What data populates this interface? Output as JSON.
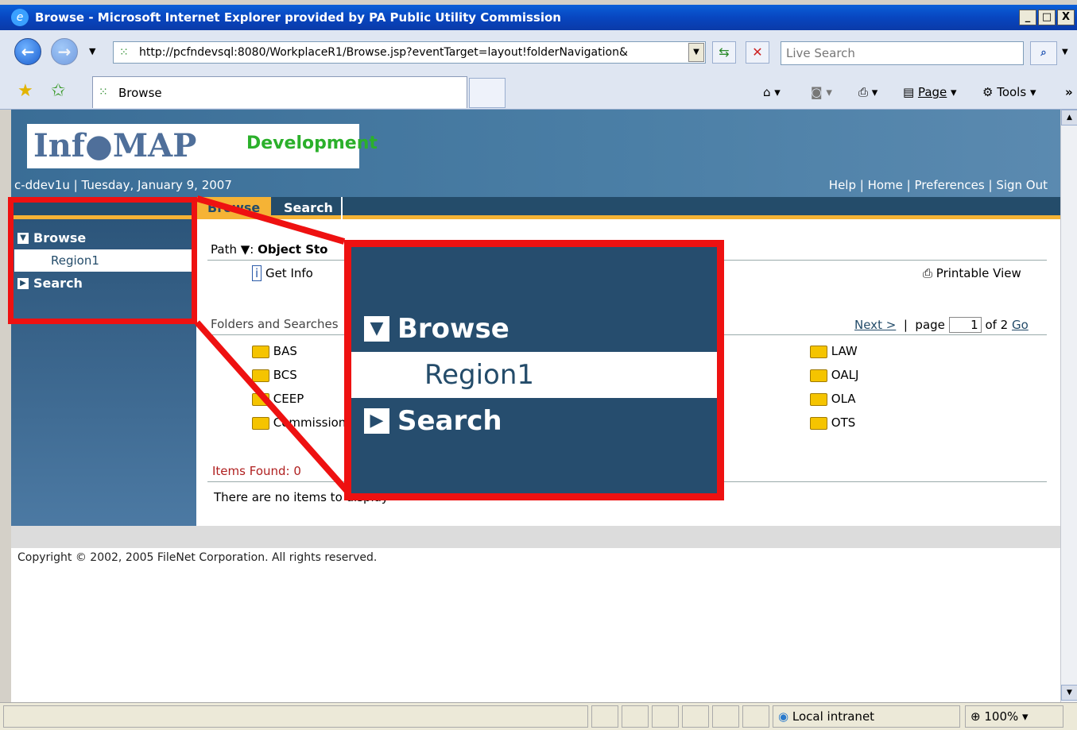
{
  "window": {
    "title": "Browse - Microsoft Internet Explorer provided by PA Public Utility Commission",
    "min": "_",
    "max": "□",
    "close": "X"
  },
  "toolbar": {
    "address": "http://pcfndevsql:8080/WorkplaceR1/Browse.jsp?eventTarget=layout!folderNavigation&",
    "search_placeholder": "Live Search",
    "tab_title": "Browse",
    "page_label": "Page",
    "tools_label": "Tools"
  },
  "header": {
    "logo_text": "Inf●MAP",
    "logo_sub": "Development",
    "user_date": "c-ddev1u | Tuesday, January 9, 2007",
    "links": [
      "Help",
      "Home",
      "Preferences",
      "Sign Out"
    ]
  },
  "tabs": [
    "Browse",
    "Search"
  ],
  "sidebar": {
    "browse": "Browse",
    "region": "Region1",
    "search": "Search"
  },
  "content": {
    "path_label": "Path",
    "path_value": "Object Sto",
    "get_info": "Get Info",
    "printable": "Printable View",
    "folders_label": "Folders and Searches",
    "next": "Next >",
    "page_word": "page",
    "page_num": "1",
    "of": "of 2",
    "go": "Go",
    "folders_left": [
      "BAS",
      "BCS",
      "CEEP",
      "Commission"
    ],
    "folders_right": [
      "LAW",
      "OALJ",
      "OLA",
      "OTS"
    ],
    "items_found": "Items Found: 0",
    "no_items": "There are no items to display"
  },
  "footer": {
    "copyright": "Copyright © 2002, 2005 FileNet Corporation. All rights reserved."
  },
  "status": {
    "zone": "Local intranet",
    "zoom": "100%"
  },
  "colors": {
    "header_blue": "#3a6d96",
    "nav_dark": "#244c6a",
    "callout_red": "#ee1111",
    "tab_accent": "#f5b335"
  }
}
